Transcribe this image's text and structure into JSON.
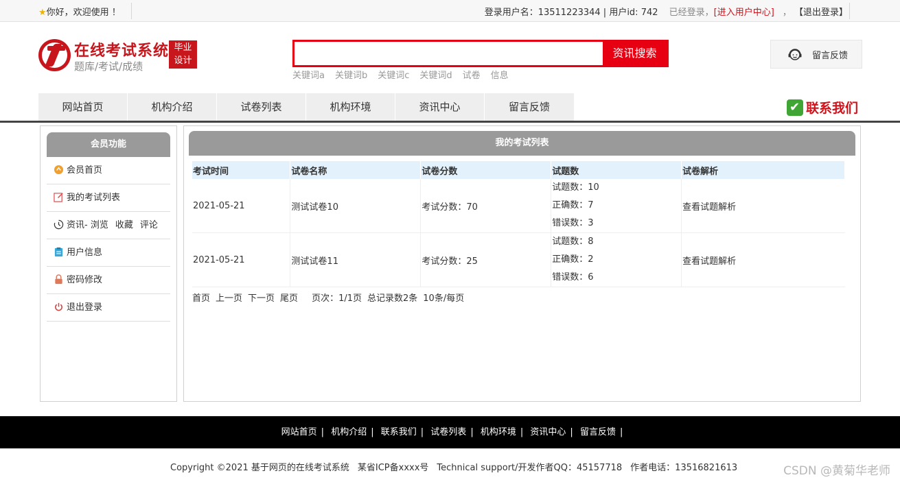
{
  "topbar": {
    "welcome": "你好，欢迎使用 ！",
    "user_info": "登录用户名：13511223344 | 用户id: 742",
    "logged_in": "已经登录，",
    "user_center": "[进入用户中心]",
    "comma": "，",
    "logout": "【退出登录】"
  },
  "header": {
    "logo_title": "在线考试系统",
    "logo_subtitle": "题库/考试/成绩",
    "badge_line1": "毕业",
    "badge_line2": "设计",
    "search_value": "",
    "search_button": "资讯搜索",
    "keywords": [
      "关键词a",
      "关键词b",
      "关键词c",
      "关键词d",
      "试卷",
      "信息"
    ],
    "feedback": "留言反馈"
  },
  "nav": {
    "items": [
      "网站首页",
      "机构介绍",
      "试卷列表",
      "机构环境",
      "资讯中心",
      "留言反馈"
    ],
    "contact": "联系我们"
  },
  "sidebar": {
    "title": "会员功能",
    "items": [
      {
        "label": "会员首页",
        "icon": "home-icon"
      },
      {
        "label": "我的考试列表",
        "icon": "edit-icon"
      },
      {
        "label": "资讯- 浏览",
        "extra1": "收藏",
        "extra2": "评论",
        "icon": "history-icon"
      },
      {
        "label": "用户信息",
        "icon": "clipboard-icon"
      },
      {
        "label": "密码修改",
        "icon": "lock-icon"
      },
      {
        "label": "退出登录",
        "icon": "power-icon"
      }
    ]
  },
  "main": {
    "title": "我的考试列表",
    "columns": [
      "考试时间",
      "试卷名称",
      "试卷分数",
      "试题数",
      "试卷解析"
    ],
    "rows": [
      {
        "time": "2021-05-21",
        "name": "测试试卷10",
        "score": "考试分数：70",
        "total": "试题数：10",
        "correct": "正确数：7",
        "wrong": "错误数：3",
        "analysis": "查看试题解析"
      },
      {
        "time": "2021-05-21",
        "name": "测试试卷11",
        "score": "考试分数：25",
        "total": "试题数：8",
        "correct": "正确数：2",
        "wrong": "错误数：6",
        "analysis": "查看试题解析"
      }
    ],
    "pager": {
      "first": "首页",
      "prev": "上一页",
      "next": "下一页",
      "last": "尾页",
      "page_info": "页次：1/1页",
      "total_info": "总记录数2条",
      "per_page": "10条/每页"
    }
  },
  "footer": {
    "links": [
      "网站首页",
      "机构介绍",
      "联系我们",
      "试卷列表",
      "机构环境",
      "资讯中心",
      "留言反馈"
    ],
    "separator": "|",
    "copyright": "Copyright ©2021 基于网页的在线考试系统",
    "icp": "某省ICP备xxxx号",
    "support": "Technical support/开发作者QQ：45157718",
    "phone": "作者电话：13516821613",
    "watermark": "CSDN @黄菊华老师"
  },
  "colors": {
    "brand_red": "#c8161d",
    "search_red": "#e60012",
    "panel_grey": "#9a9a9a",
    "table_header": "#e2f1fc"
  }
}
